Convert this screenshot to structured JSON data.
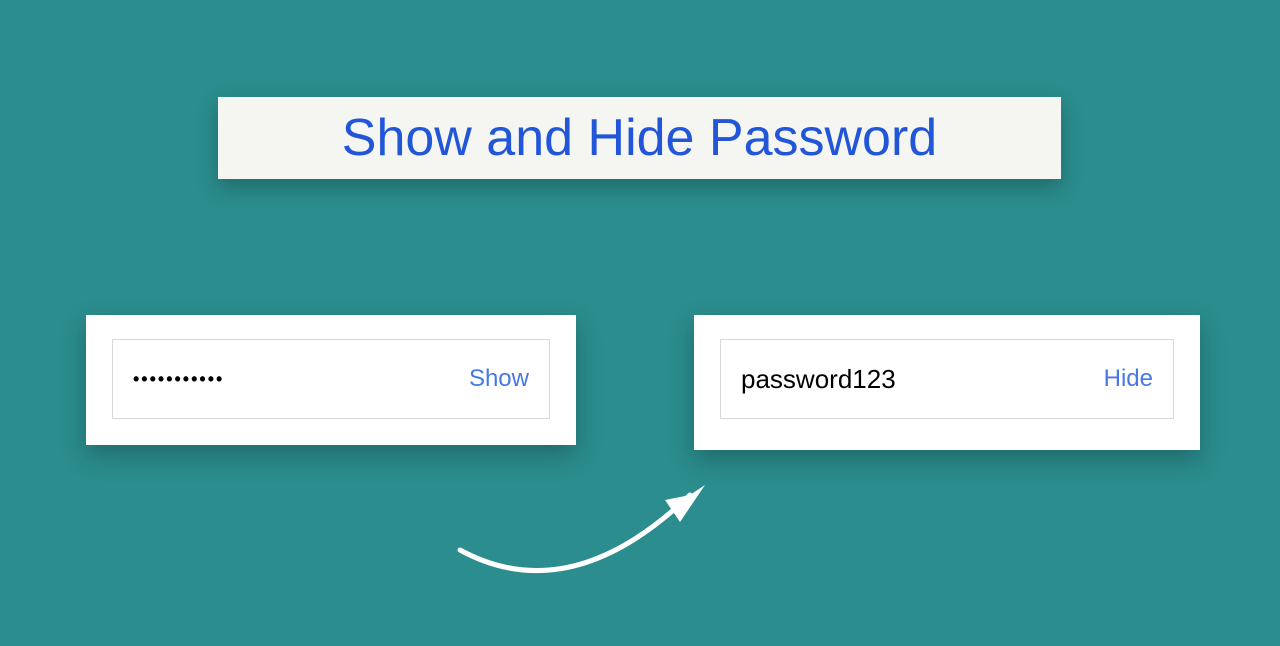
{
  "title": "Show and Hide Password",
  "left_card": {
    "masked_value": "•••••••••••",
    "toggle_label": "Show"
  },
  "right_card": {
    "plain_value": "password123",
    "toggle_label": "Hide"
  }
}
